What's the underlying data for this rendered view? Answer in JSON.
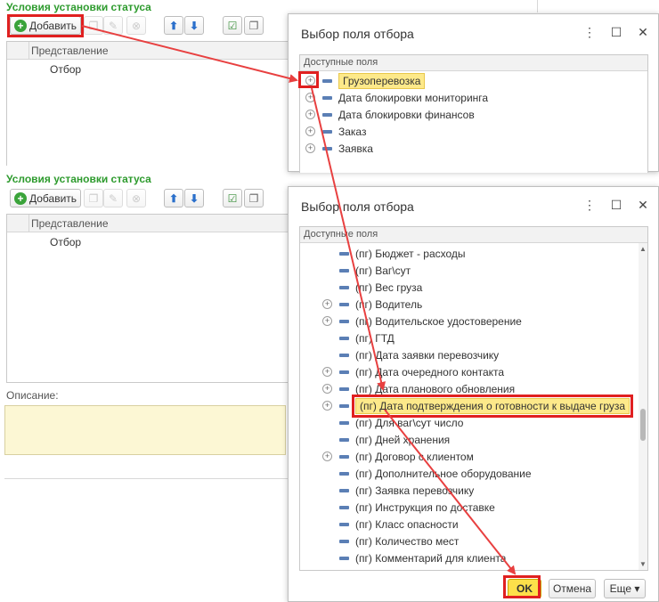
{
  "top_form": {
    "title": "Условия установки статуса",
    "add_label": "Добавить",
    "grid_header": "Представление",
    "row": "Отбор"
  },
  "bottom_form": {
    "title": "Условия установки статуса",
    "add_label": "Добавить",
    "grid_header": "Представление",
    "row": "Отбор",
    "description_label": "Описание:"
  },
  "dialog1": {
    "title": "Выбор поля отбора",
    "tree_header": "Доступные поля",
    "items": [
      {
        "label": "Грузоперевозка",
        "expandable": true,
        "selected": true
      },
      {
        "label": "Дата блокировки мониторинга",
        "expandable": true
      },
      {
        "label": "Дата блокировки финансов",
        "expandable": true
      },
      {
        "label": "Заказ",
        "expandable": true
      },
      {
        "label": "Заявка",
        "expandable": true
      }
    ]
  },
  "dialog2": {
    "title": "Выбор поля отбора",
    "tree_header": "Доступные поля",
    "items": [
      {
        "label": "(пг) Бюджет - расходы",
        "expandable": false
      },
      {
        "label": "(пг) Ваг\\сут",
        "expandable": false
      },
      {
        "label": "(пг) Вес груза",
        "expandable": false
      },
      {
        "label": "(пг) Водитель",
        "expandable": true
      },
      {
        "label": "(пг) Водительское удостоверение",
        "expandable": true
      },
      {
        "label": "(пг) ГТД",
        "expandable": false
      },
      {
        "label": "(пг) Дата заявки перевозчику",
        "expandable": false
      },
      {
        "label": "(пг) Дата очередного контакта",
        "expandable": true
      },
      {
        "label": "(пг) Дата планового обновления",
        "expandable": true
      },
      {
        "label": "(пг) Дата подтверждения о готовности к выдаче груза",
        "expandable": true,
        "selected": true
      },
      {
        "label": "(пг) Для ваг\\сут число",
        "expandable": false
      },
      {
        "label": "(пг) Дней хранения",
        "expandable": false
      },
      {
        "label": "(пг) Договор с клиентом",
        "expandable": true
      },
      {
        "label": "(пг) Дополнительное оборудование",
        "expandable": false
      },
      {
        "label": "(пг) Заявка перевозчику",
        "expandable": false
      },
      {
        "label": "(пг) Инструкция по доставке",
        "expandable": false
      },
      {
        "label": "(пг) Класс опасности",
        "expandable": false
      },
      {
        "label": "(пг) Количество мест",
        "expandable": false
      },
      {
        "label": "(пг) Комментарий для клиента",
        "expandable": false
      }
    ],
    "ok_label": "OK",
    "cancel_label": "Отмена",
    "more_label": "Еще ▾"
  },
  "colors": {
    "title_green": "#2e9b2e",
    "highlight_red": "#e02020",
    "selection_yellow": "#fde98a",
    "ok_yellow": "#fde04a"
  }
}
